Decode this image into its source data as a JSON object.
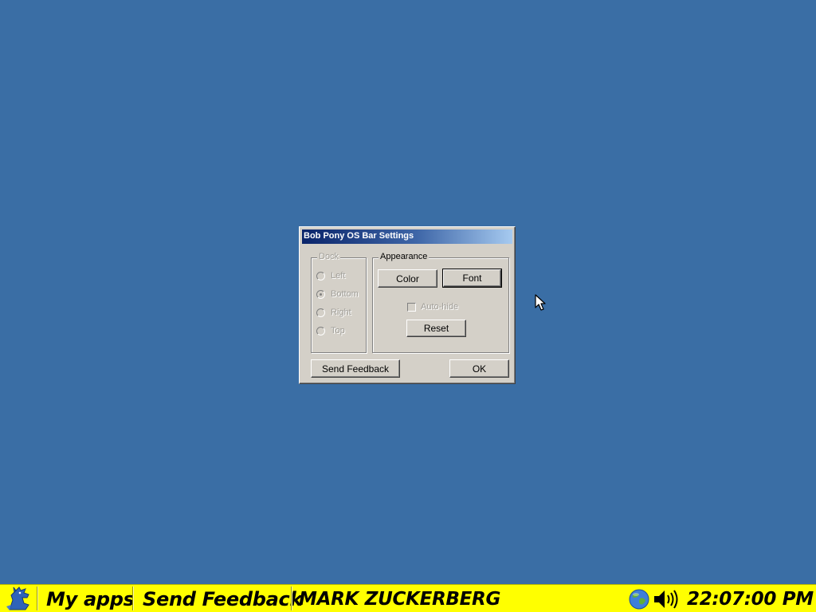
{
  "dialog": {
    "title": "Bob Pony OS Bar Settings",
    "dock_group": {
      "label": "Dock",
      "options": [
        {
          "label": "Left",
          "checked": false
        },
        {
          "label": "Bottom",
          "checked": true
        },
        {
          "label": "Right",
          "checked": false
        },
        {
          "label": "Top",
          "checked": false
        }
      ]
    },
    "appearance_group": {
      "label": "Appearance",
      "color_label": "Color",
      "font_label": "Font",
      "autohide_label": "Auto-hide",
      "autohide_checked": false,
      "reset_label": "Reset"
    },
    "send_feedback_label": "Send Feedback",
    "ok_label": "OK"
  },
  "taskbar": {
    "my_apps_label": "My apps",
    "send_feedback_label": "Send Feedback",
    "user_name": "MARK ZUCKERBERG",
    "clock": "22:07:00 PM",
    "start_icon": "pony-logo-icon",
    "tray_icons": [
      "globe-icon",
      "volume-icon"
    ]
  },
  "colors": {
    "desktop": "#3a6ea5",
    "taskbar": "#ffff00",
    "titlebar_start": "#0a246a",
    "titlebar_end": "#a6caf0",
    "dialog_face": "#d4d0c8"
  }
}
